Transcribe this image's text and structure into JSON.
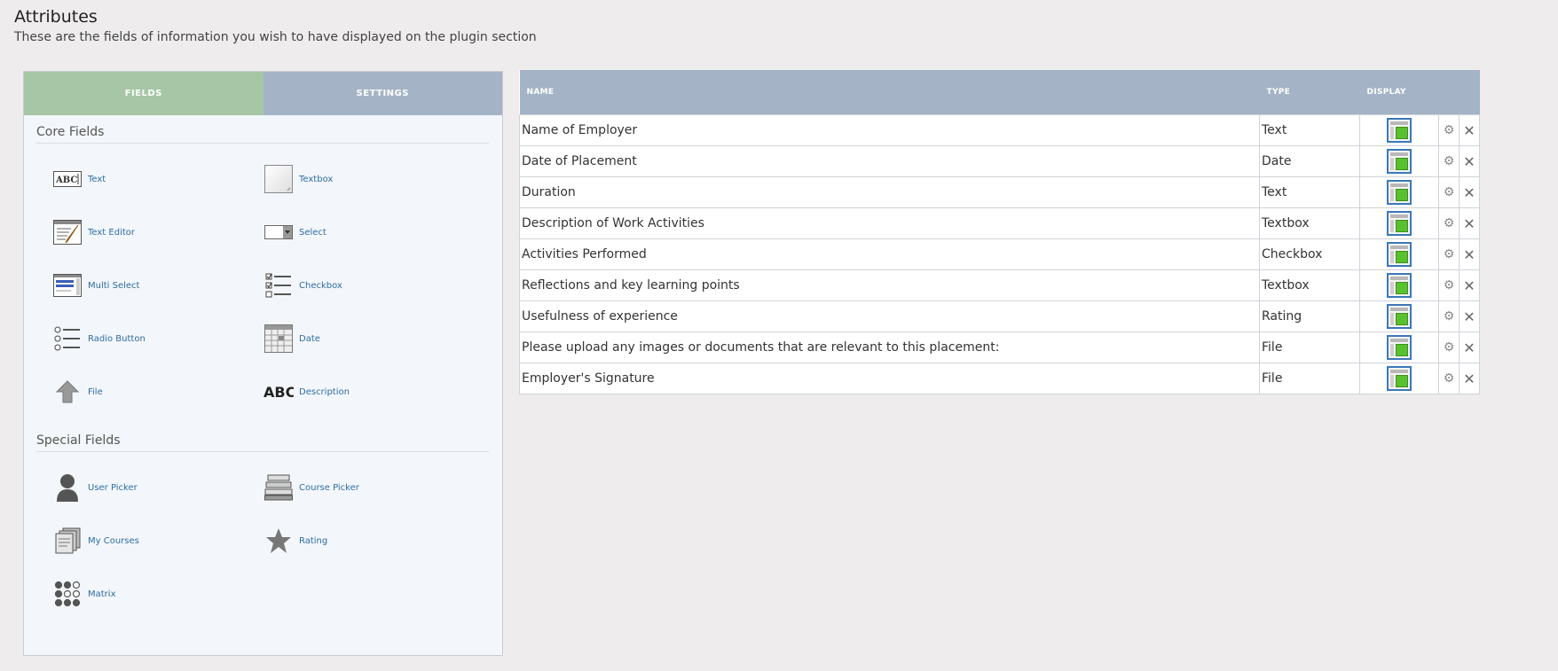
{
  "header": {
    "title": "Attributes",
    "subtitle": "These are the fields of information you wish to have displayed on the plugin section"
  },
  "palette": {
    "tabs": [
      {
        "label": "FIELDS",
        "active": true
      },
      {
        "label": "SETTINGS",
        "active": false
      }
    ],
    "core_title": "Core Fields",
    "core_fields": [
      {
        "label": "Text",
        "icon": "text-abc-icon"
      },
      {
        "label": "Textbox",
        "icon": "textbox-icon"
      },
      {
        "label": "Text Editor",
        "icon": "text-editor-icon"
      },
      {
        "label": "Select",
        "icon": "select-icon"
      },
      {
        "label": "Multi Select",
        "icon": "multi-select-icon"
      },
      {
        "label": "Checkbox",
        "icon": "checkbox-list-icon"
      },
      {
        "label": "Radio Button",
        "icon": "radio-list-icon"
      },
      {
        "label": "Date",
        "icon": "calendar-icon"
      },
      {
        "label": "File",
        "icon": "upload-arrow-icon"
      },
      {
        "label": "Description",
        "icon": "description-abc-icon"
      }
    ],
    "special_title": "Special Fields",
    "special_fields": [
      {
        "label": "User Picker",
        "icon": "user-icon"
      },
      {
        "label": "Course Picker",
        "icon": "books-icon"
      },
      {
        "label": "My Courses",
        "icon": "documents-stack-icon"
      },
      {
        "label": "Rating",
        "icon": "star-icon"
      },
      {
        "label": "Matrix",
        "icon": "matrix-grid-icon"
      }
    ]
  },
  "table": {
    "headers": {
      "name": "NAME",
      "type": "TYPE",
      "display": "DISPLAY"
    },
    "rows": [
      {
        "name": "Name of Employer",
        "type": "Text"
      },
      {
        "name": "Date of Placement",
        "type": "Date"
      },
      {
        "name": "Duration",
        "type": "Text"
      },
      {
        "name": "Description of Work Activities",
        "type": "Textbox"
      },
      {
        "name": "Activities Performed",
        "type": "Checkbox"
      },
      {
        "name": "Reflections and key learning points",
        "type": "Textbox"
      },
      {
        "name": "Usefulness of experience",
        "type": "Rating"
      },
      {
        "name": "Please upload any images or documents that are relevant to this placement:",
        "type": "File"
      },
      {
        "name": "Employer's Signature",
        "type": "File"
      }
    ]
  },
  "colors": {
    "tab_active": "#a6c6a5",
    "tab_inactive": "#a4b4c6",
    "header_bg": "#a4b4c6",
    "link": "#2e6da4",
    "display_green": "#59c12f"
  }
}
